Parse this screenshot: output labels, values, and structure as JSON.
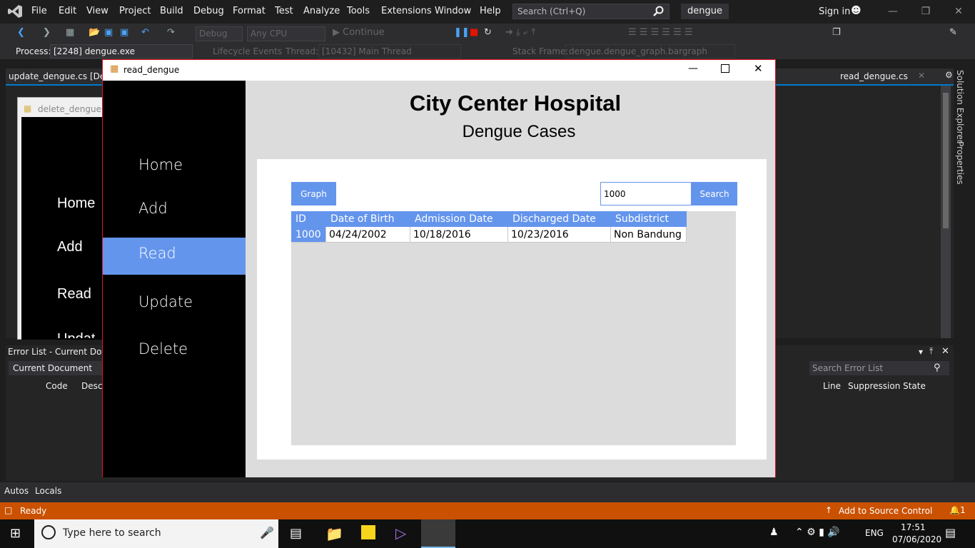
{
  "vs": {
    "menu": [
      "File",
      "Edit",
      "View",
      "Project",
      "Build",
      "Debug",
      "Format",
      "Test",
      "Analyze",
      "Tools",
      "Extensions",
      "Window",
      "Help"
    ],
    "search_placeholder": "Search (Ctrl+Q)",
    "solution": "dengue",
    "signin": "Sign in",
    "toolbar": {
      "config": "Debug",
      "platform": "Any CPU",
      "continue": "Continue"
    },
    "debugbar": {
      "process_label": "Process:",
      "process": "[2248] dengue.exe",
      "lifecycle": "Lifecycle Events",
      "thread_label": "Thread:",
      "thread": "[10432] Main Thread",
      "stack_label": "Stack Frame:",
      "stack": "dengue.dengue_graph.bargraph"
    },
    "tabs": {
      "left": "update_dengue.cs [Desig",
      "right": "read_dengue.cs"
    },
    "side_tabs": [
      "Solution Explorer",
      "Properties"
    ],
    "designer": {
      "title": "delete_dengue",
      "items": [
        "Home",
        "Add",
        "Read",
        "Updat"
      ]
    },
    "errlist": {
      "title": "Error List - Current Docu",
      "scope": "Current Document",
      "cols": [
        "Code",
        "Descr"
      ],
      "right_cols": [
        "Line",
        "Suppression State"
      ],
      "search": "Search Error List"
    },
    "bottom_tabs": [
      "Autos",
      "Locals"
    ],
    "status": {
      "text": "Ready",
      "source_control": "Add to Source Control",
      "notif": "1"
    }
  },
  "taskbar": {
    "search": "Type here to search",
    "lang": "ENG",
    "time": "17:51",
    "date": "07/06/2020"
  },
  "app": {
    "title": "read_dengue",
    "nav": [
      "Home",
      "Add",
      "Read",
      "Update",
      "Delete"
    ],
    "active_nav": "Read",
    "hospital": "City Center Hospital",
    "subtitle": "Dengue Cases",
    "graph_btn": "Graph",
    "search_value": "1000",
    "search_btn": "Search",
    "columns": [
      "ID",
      "Date of Birth",
      "Admission Date",
      "Discharged Date",
      "Subdistrict"
    ],
    "rows": [
      [
        "1000",
        "04/24/2002",
        "10/18/2016",
        "10/23/2016",
        "Non Bandung"
      ]
    ]
  }
}
